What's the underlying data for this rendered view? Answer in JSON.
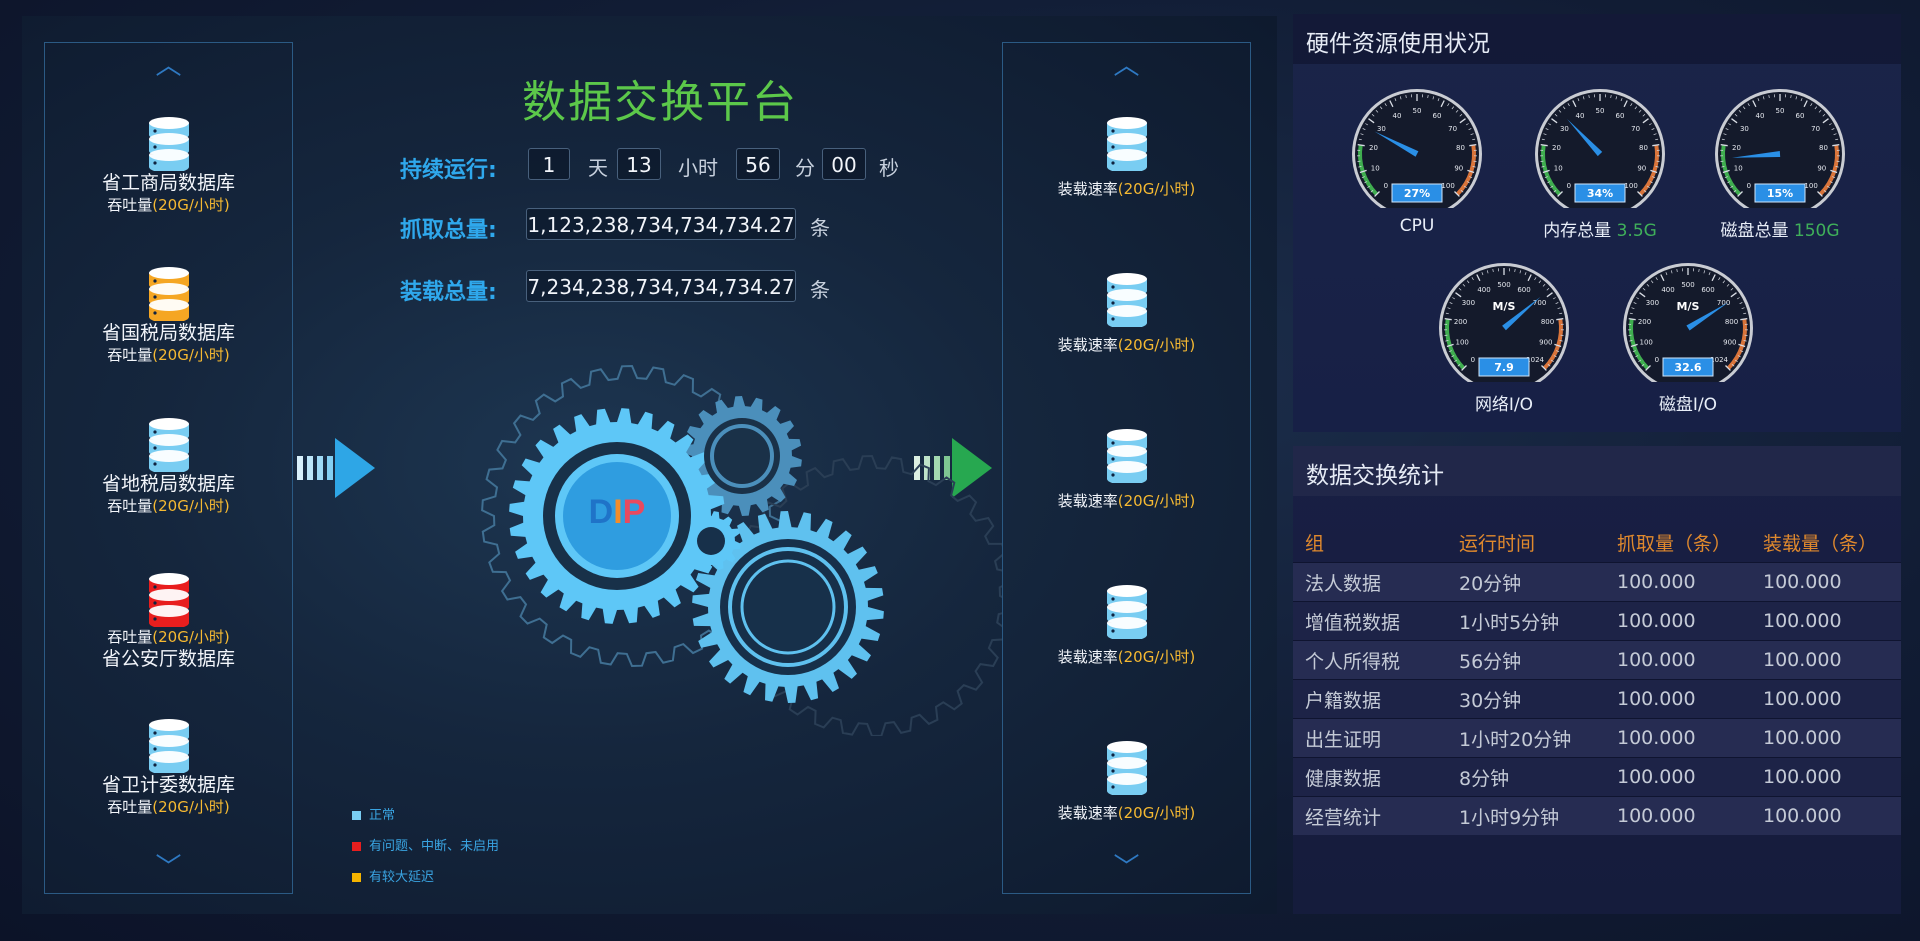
{
  "title": "数据交换平台",
  "runtime": {
    "label": "持续运行:",
    "days": "1",
    "day_unit": "天",
    "hours": "13",
    "hour_unit": "小时",
    "minutes": "56",
    "minute_unit": "分",
    "seconds": "00",
    "second_unit": "秒"
  },
  "crawl": {
    "label": "抓取总量:",
    "value": "1,123,238,734,734,734.27",
    "unit": "条"
  },
  "load": {
    "label": "装载总量:",
    "value": "7,234,238,734,734,734.27",
    "unit": "条"
  },
  "logo_text": "DIP",
  "colors": {
    "normal": "#79cdf2",
    "problem": "#e81e1e",
    "delay": "#f5a623",
    "accent_green": "#5cc84a",
    "accent_blue": "#2fa8ec"
  },
  "sources": [
    {
      "name": "省工商局数据库",
      "sub_prefix": "吞吐量",
      "sub_value": "(20G/小时)",
      "status": "normal"
    },
    {
      "name": "省国税局数据库",
      "sub_prefix": "吞吐量",
      "sub_value": "(20G/小时)",
      "status": "delay"
    },
    {
      "name": "省地税局数据库",
      "sub_prefix": "吞吐量",
      "sub_value": "(20G/小时)",
      "status": "normal"
    },
    {
      "name": "省公安厅数据库",
      "sub_prefix": "吞吐量",
      "sub_value": "(20G/小时)",
      "status": "problem"
    },
    {
      "name": "省卫计委数据库",
      "sub_prefix": "吞吐量",
      "sub_value": "(20G/小时)",
      "status": "normal"
    }
  ],
  "targets": [
    {
      "prefix": "装载速率",
      "value": "(20G/小时)"
    },
    {
      "prefix": "装载速率",
      "value": "(20G/小时)"
    },
    {
      "prefix": "装载速率",
      "value": "(20G/小时)"
    },
    {
      "prefix": "装载速率",
      "value": "(20G/小时)"
    },
    {
      "prefix": "装载速率",
      "value": "(20G/小时)"
    }
  ],
  "legend": [
    {
      "label": "正常",
      "status": "normal"
    },
    {
      "label": "有问题、中断、未启用",
      "status": "problem"
    },
    {
      "label": "有较大延迟",
      "status": "delay"
    }
  ],
  "hardware": {
    "title": "硬件资源使用状况",
    "gauges": [
      {
        "label": "CPU",
        "extra": "",
        "readout": "27%",
        "value": 27,
        "max": 100,
        "ticks": [
          "0",
          "10",
          "20",
          "30",
          "40",
          "50",
          "60",
          "70",
          "80",
          "90",
          "100"
        ],
        "unit": ""
      },
      {
        "label": "内存总量",
        "extra": "3.5G",
        "readout": "34%",
        "value": 34,
        "max": 100,
        "ticks": [
          "0",
          "10",
          "20",
          "30",
          "40",
          "50",
          "60",
          "70",
          "80",
          "90",
          "100"
        ],
        "unit": ""
      },
      {
        "label": "磁盘总量",
        "extra": "150G",
        "readout": "15%",
        "value": 15,
        "max": 100,
        "ticks": [
          "0",
          "10",
          "20",
          "30",
          "40",
          "50",
          "60",
          "70",
          "80",
          "90",
          "100"
        ],
        "unit": ""
      },
      {
        "label": "网络I/O",
        "extra": "",
        "readout": "7.9",
        "value": 700,
        "max": 1024,
        "ticks": [
          "0",
          "100",
          "200",
          "300",
          "400",
          "500",
          "600",
          "700",
          "800",
          "900",
          "1024"
        ],
        "unit": "M/S"
      },
      {
        "label": "磁盘I/O",
        "extra": "",
        "readout": "32.6",
        "value": 730,
        "max": 1024,
        "ticks": [
          "0",
          "100",
          "200",
          "300",
          "400",
          "500",
          "600",
          "700",
          "800",
          "900",
          "1024"
        ],
        "unit": "M/S"
      }
    ]
  },
  "stats": {
    "title": "数据交换统计",
    "columns": [
      "组",
      "运行时间",
      "抓取量（条）",
      "装载量（条）"
    ],
    "rows": [
      [
        "法人数据",
        "20分钟",
        "100.000",
        "100.000"
      ],
      [
        "增值税数据",
        "1小时5分钟",
        "100.000",
        "100.000"
      ],
      [
        "个人所得税",
        "56分钟",
        "100.000",
        "100.000"
      ],
      [
        "户籍数据",
        "30分钟",
        "100.000",
        "100.000"
      ],
      [
        "出生证明",
        "1小时20分钟",
        "100.000",
        "100.000"
      ],
      [
        "健康数据",
        "8分钟",
        "100.000",
        "100.000"
      ],
      [
        "经营统计",
        "1小时9分钟",
        "100.000",
        "100.000"
      ]
    ]
  }
}
